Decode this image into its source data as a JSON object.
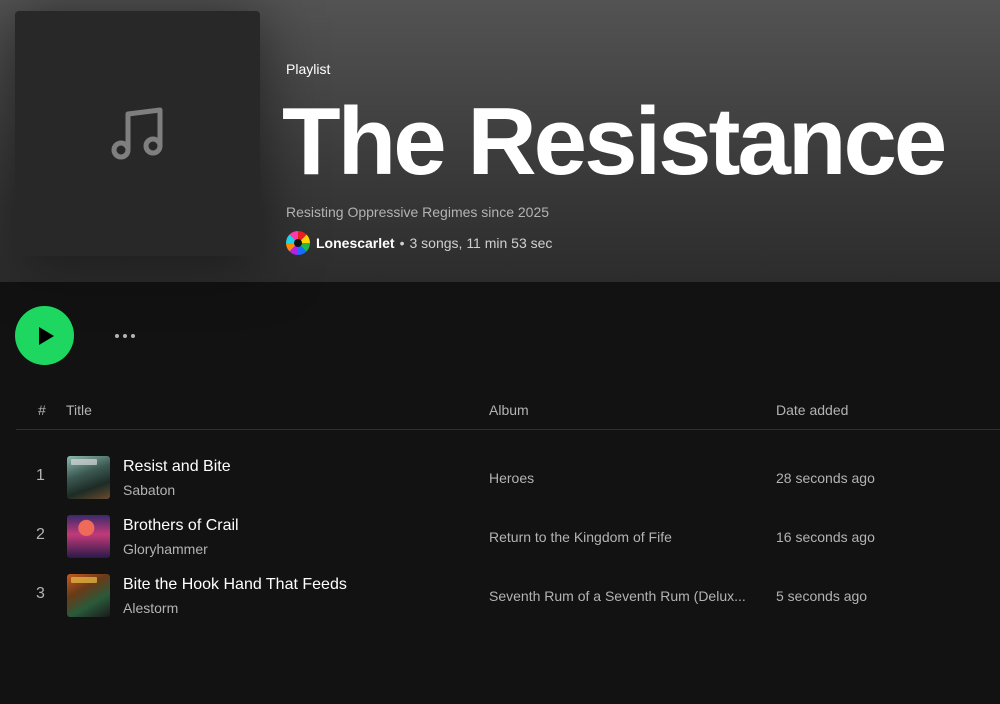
{
  "playlist": {
    "kind": "Playlist",
    "title": "The Resistance",
    "description": "Resisting Oppressive Regimes since 2025",
    "owner": "Lonescarlet",
    "separator": "•",
    "stats": "3 songs, 11 min 53 sec",
    "cover_icon": "music-note-icon"
  },
  "controls": {
    "play_icon": "play-icon",
    "more_icon": "more-options-icon"
  },
  "table": {
    "headers": {
      "num": "#",
      "title": "Title",
      "album": "Album",
      "date": "Date added"
    },
    "rows": [
      {
        "num": "1",
        "title": "Resist and Bite",
        "artist": "Sabaton",
        "album": "Heroes",
        "date": "28 seconds ago"
      },
      {
        "num": "2",
        "title": "Brothers of Crail",
        "artist": "Gloryhammer",
        "album": "Return to the Kingdom of Fife",
        "date": "16 seconds ago"
      },
      {
        "num": "3",
        "title": "Bite the Hook Hand That Feeds",
        "artist": "Alestorm",
        "album": "Seventh Rum of a Seventh Rum (Delux...",
        "date": "5 seconds ago"
      }
    ]
  },
  "colors": {
    "accent": "#1ed760",
    "background": "#121212",
    "secondary_text": "#b3b3b3"
  }
}
